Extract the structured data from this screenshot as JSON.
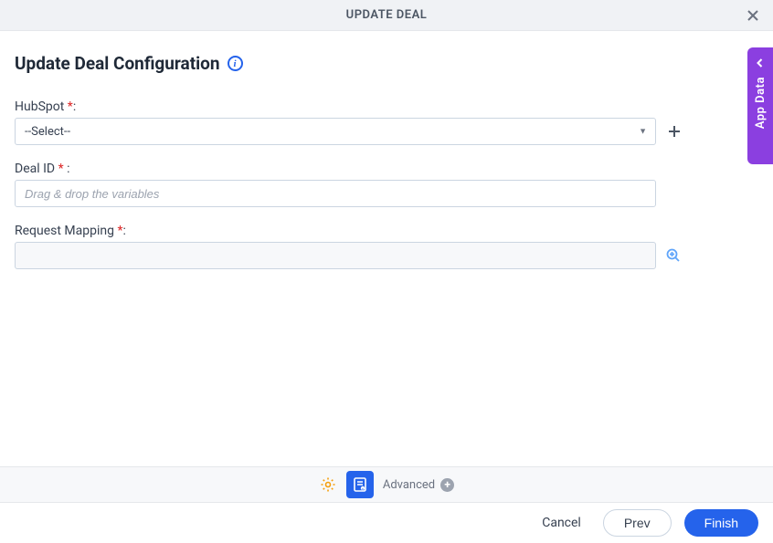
{
  "header": {
    "title": "UPDATE DEAL"
  },
  "page": {
    "title": "Update Deal Configuration"
  },
  "fields": {
    "hubspot": {
      "label": "HubSpot ",
      "required": "*",
      "colon": ":",
      "selected": "--Select--"
    },
    "dealId": {
      "label": "Deal ID  ",
      "required": "*",
      "colon": " :",
      "placeholder": "Drag & drop the variables",
      "value": ""
    },
    "requestMapping": {
      "label": "Request Mapping ",
      "required": "*",
      "colon": ":",
      "value": ""
    }
  },
  "toolbar": {
    "advanced_label": "Advanced"
  },
  "footer": {
    "cancel": "Cancel",
    "prev": "Prev",
    "finish": "Finish"
  },
  "sideTab": {
    "label": "App Data"
  }
}
